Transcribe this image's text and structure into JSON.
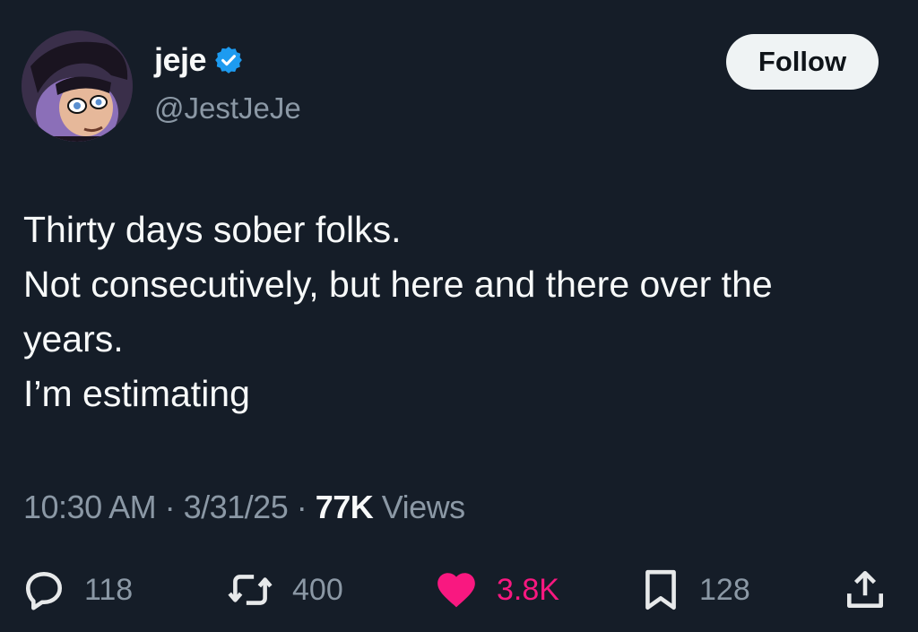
{
  "user": {
    "display_name": "jeje",
    "handle": "@JestJeJe",
    "verified_icon": "verified-badge-icon",
    "avatar": "cartoon-character-avatar"
  },
  "follow_label": "Follow",
  "tweet": {
    "lines": [
      "Thirty days sober folks.",
      "Not consecutively, but here and there over the",
      "years.",
      "I’m estimating"
    ]
  },
  "meta": {
    "time": "10:30 AM",
    "sep1": " · ",
    "date": "3/31/25",
    "sep2": " · ",
    "views_count": "77K",
    "views_label": " Views"
  },
  "actions": {
    "replies": {
      "icon": "reply-icon",
      "count": "118"
    },
    "retweets": {
      "icon": "retweet-icon",
      "count": "400"
    },
    "likes": {
      "icon": "heart-icon",
      "count": "3.8K",
      "color": "#f91880"
    },
    "bookmarks": {
      "icon": "bookmark-icon",
      "count": "128"
    },
    "share": {
      "icon": "share-icon"
    }
  },
  "colors": {
    "background": "#151d28",
    "primary_text": "#f7f9f9",
    "secondary_text": "#8b98a5",
    "verified": "#1d9bf0",
    "like": "#f91880"
  }
}
